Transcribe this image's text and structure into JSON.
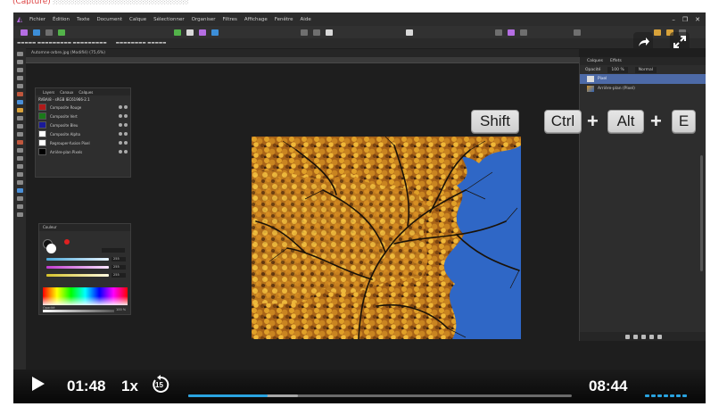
{
  "player": {
    "play_icon": "play-icon",
    "current_time": "01:48",
    "speed": "1x",
    "skip_back_seconds": "15",
    "duration": "08:44",
    "progress_fraction": 0.207,
    "buffered_fraction": 0.285,
    "accent_color": "#29a3e0",
    "share_icon": "share-icon",
    "expand_icon": "expand-icon"
  },
  "shortcut": {
    "key_shift": "Shift",
    "key_ctrl": "Ctrl",
    "key_alt": "Alt",
    "key_e": "E",
    "plus": "+"
  },
  "app": {
    "menus": [
      "Fichier",
      "Édition",
      "Texte",
      "Document",
      "Calque",
      "Sélectionner",
      "Organiser",
      "Filtres",
      "Affichage",
      "Fenêtre",
      "Aide"
    ],
    "document_tab": "Automne-arbre.jpg (Modifié) (75,6%)"
  },
  "layers_panel": {
    "tabs": [
      "Layers",
      "Canaux",
      "Calques"
    ],
    "header": "RVBA/8 - sRGB IEC61966-2.1",
    "rows": [
      {
        "label": "Composite Rouge",
        "swatch": "#b01a1a"
      },
      {
        "label": "Composite Vert",
        "swatch": "#1a7a1a"
      },
      {
        "label": "Composite Bleu",
        "swatch": "#1a1a9a"
      },
      {
        "label": "Composite Alpha",
        "swatch": "#ffffff"
      },
      {
        "label": "Regrouper-fusion Pixel",
        "swatch": "#ffffff"
      },
      {
        "label": "Arrière-plan Pixels",
        "swatch": "#000000"
      }
    ]
  },
  "color_panel": {
    "title": "Couleur",
    "slider_values": [
      "255",
      "255",
      "255"
    ],
    "opacity_label": "Opacité",
    "opacity_value": "100 %"
  },
  "right_panel": {
    "tabs": [
      "Calques",
      "Effets"
    ],
    "opacity_label": "Opacité",
    "opacity_value": "100 %",
    "blend_mode": "Normal",
    "layers": [
      {
        "label": "Pixel",
        "selected": true
      },
      {
        "label": "Arrière-plan (Pixel)",
        "selected": false
      }
    ]
  }
}
